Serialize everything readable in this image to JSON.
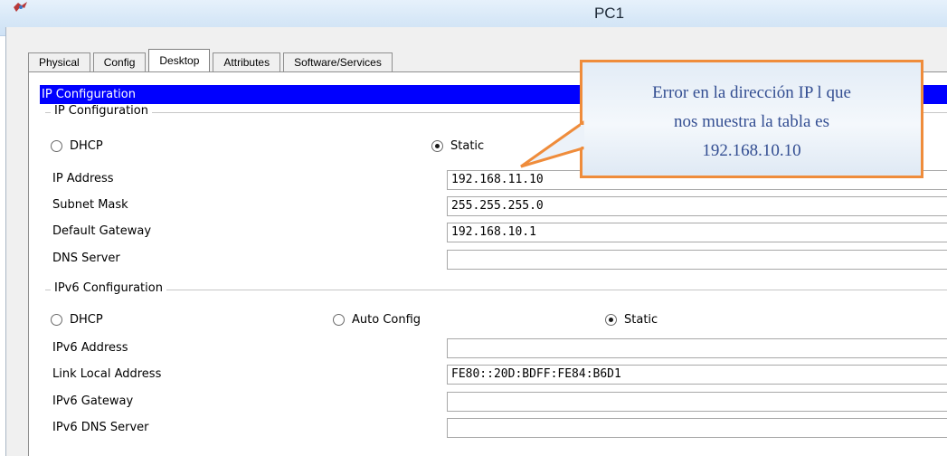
{
  "window": {
    "title": "PC1"
  },
  "tabs": [
    {
      "label": "Physical",
      "active": false
    },
    {
      "label": "Config",
      "active": false
    },
    {
      "label": "Desktop",
      "active": true
    },
    {
      "label": "Attributes",
      "active": false
    },
    {
      "label": "Software/Services",
      "active": false
    }
  ],
  "section_header": "IP Configuration",
  "ipv4": {
    "group_label": "IP Configuration",
    "dhcp_label": "DHCP",
    "static_label": "Static",
    "selected": "Static",
    "fields": [
      {
        "label": "IP Address",
        "value": "192.168.11.10"
      },
      {
        "label": "Subnet Mask",
        "value": "255.255.255.0"
      },
      {
        "label": "Default Gateway",
        "value": "192.168.10.1"
      },
      {
        "label": "DNS Server",
        "value": ""
      }
    ]
  },
  "ipv6": {
    "group_label": "IPv6 Configuration",
    "dhcp_label": "DHCP",
    "auto_label": "Auto Config",
    "static_label": "Static",
    "selected": "Static",
    "fields": [
      {
        "label": "IPv6 Address",
        "value": ""
      },
      {
        "label": "Link Local Address",
        "value": "FE80::20D:BDFF:FE84:B6D1"
      },
      {
        "label": "IPv6 Gateway",
        "value": ""
      },
      {
        "label": "IPv6 DNS Server",
        "value": ""
      }
    ]
  },
  "callout": {
    "lines": [
      "Error en la dirección IP l que",
      "nos muestra la tabla es",
      "192.168.10.10"
    ]
  },
  "colors": {
    "header_bg": "#0000ff",
    "callout_border": "#ef8c3b",
    "callout_text": "#334e92"
  },
  "icons": {
    "app": "packet-tracer-icon"
  }
}
